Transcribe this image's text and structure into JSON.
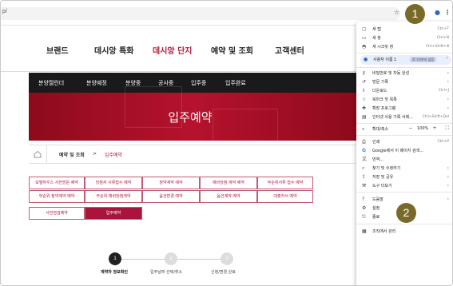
{
  "browser": {
    "url_fragment": "p/",
    "star_icon": "star-icon",
    "profile_icon": "person-icon",
    "menu_icon": "kebab-menu-icon"
  },
  "markers": {
    "one": "1",
    "two": "2"
  },
  "nav": {
    "items": [
      "브랜드",
      "데시앙 특화",
      "데시앙 단지",
      "예약 및 조회",
      "고객센터"
    ],
    "active": "데시앙 단지"
  },
  "subnav": {
    "items": [
      "분양캘린더",
      "분양예정",
      "분양중",
      "공사중",
      "입주중",
      "입주완료"
    ]
  },
  "hero": {
    "title": "입주예약"
  },
  "breadcrumb": {
    "home_icon": "home-icon",
    "section": "예약 및 조회",
    "separator": ">",
    "current": "입주예약"
  },
  "tabs": {
    "row1": [
      "모델하우스 사전방문 예약",
      "당첨자 서류접수 예약",
      "청약계약 예약",
      "예비당첨 계약 예약",
      "무순위서류 접수 예약"
    ],
    "row2": [
      "무순위 청약계약 예약",
      "무순위 예비당첨계약",
      "옵션변경 예약",
      "옵션계약 예약",
      "대출자서 예약"
    ],
    "row3": [
      "사전점검예약",
      "입주예약"
    ],
    "active": "입주예약"
  },
  "steps": {
    "dots": [
      "1",
      "2",
      "3"
    ],
    "labels": [
      "계약자 정보확인",
      "입주날짜 선택/취소",
      "신청/변경 완료"
    ]
  },
  "menu": {
    "items": [
      {
        "icon": "new-tab-icon",
        "label": "새 탭",
        "shortcut": "Ctrl+T"
      },
      {
        "icon": "new-window-icon",
        "label": "새 창",
        "shortcut": "Ctrl+N"
      },
      {
        "icon": "incognito-icon",
        "label": "새 시크릿 창",
        "shortcut": "Ctrl+Shift+N"
      }
    ],
    "profile": {
      "label": "사용자 이름 1",
      "badge": "로그인하지 않음"
    },
    "items2": [
      {
        "icon": "key-icon",
        "label": "비밀번호 및 자동 완성",
        "shortcut": ""
      },
      {
        "icon": "history-icon",
        "label": "방문 기록",
        "shortcut": ""
      },
      {
        "icon": "download-icon",
        "label": "다운로드",
        "shortcut": "Ctrl+J"
      },
      {
        "icon": "bookmark-icon",
        "label": "북마크 및 목록",
        "shortcut": ""
      },
      {
        "icon": "extension-icon",
        "label": "확장 프로그램",
        "shortcut": ""
      },
      {
        "icon": "trash-icon",
        "label": "인터넷 사용 기록 삭제...",
        "shortcut": "Ctrl+Shift+Del"
      }
    ],
    "zoom": {
      "label": "확대/축소",
      "minus": "−",
      "value": "100%",
      "plus": "+",
      "fullscreen": "⛶"
    },
    "items3": [
      {
        "icon": "print-icon",
        "label": "인쇄",
        "shortcut": "Ctrl+P"
      },
      {
        "icon": "google-icon",
        "label": "Google에서 이 페이지 검색...",
        "shortcut": ""
      },
      {
        "icon": "translate-icon",
        "label": "번역...",
        "shortcut": ""
      },
      {
        "icon": "search-icon",
        "label": "찾기 및 수정하기",
        "shortcut": ""
      },
      {
        "icon": "cast-icon",
        "label": "저장 및 공유",
        "shortcut": ""
      },
      {
        "icon": "tools-icon",
        "label": "도구 더보기",
        "shortcut": ""
      }
    ],
    "items4": [
      {
        "icon": "help-icon",
        "label": "도움말",
        "shortcut": ""
      },
      {
        "icon": "settings-icon",
        "label": "설정",
        "shortcut": ""
      },
      {
        "icon": "exit-icon",
        "label": "종료",
        "shortcut": ""
      }
    ],
    "managed": {
      "icon": "building-icon",
      "label": "조직에서 관리"
    }
  }
}
